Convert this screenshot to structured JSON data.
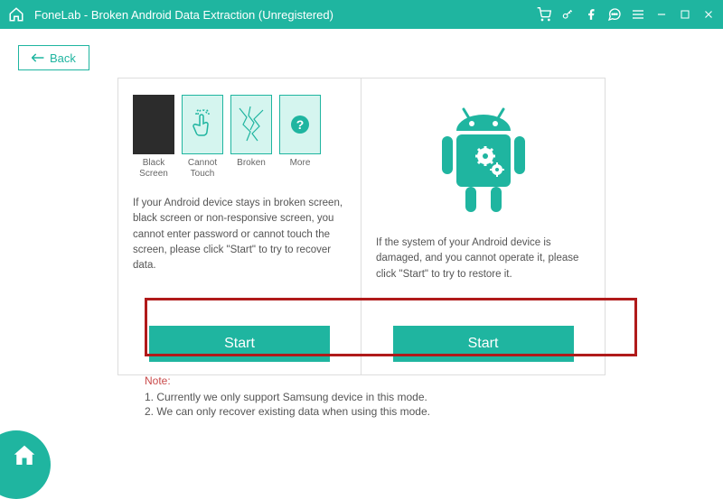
{
  "title": "FoneLab - Broken Android Data Extraction (Unregistered)",
  "back": "Back",
  "left_panel": {
    "icons": {
      "black": "Black\nScreen",
      "touch": "Cannot\nTouch",
      "broken": "Broken",
      "more": "More"
    },
    "desc": "If your Android device stays in broken screen, black screen or non-responsive screen, you cannot enter password or cannot touch the screen, please click \"Start\" to try to recover data.",
    "start": "Start"
  },
  "right_panel": {
    "desc": "If the system of your Android device is damaged, and you cannot operate it, please click \"Start\" to try to restore it.",
    "start": "Start"
  },
  "note": {
    "title": "Note:",
    "line1": "1. Currently we only support Samsung device in this mode.",
    "line2": "2. We can only recover existing data when using this mode."
  }
}
